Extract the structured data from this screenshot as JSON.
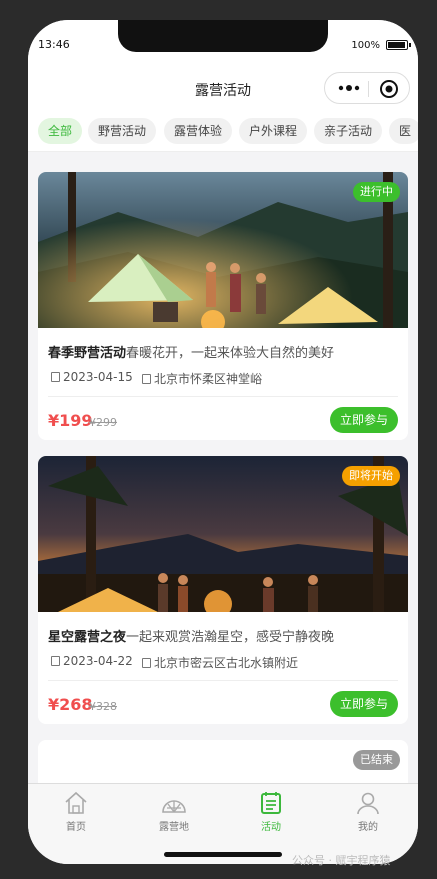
{
  "status": {
    "time": "13:46",
    "battery": "100%"
  },
  "nav": {
    "title": "露营活动"
  },
  "tabs": [
    "全部",
    "野营活动",
    "露营体验",
    "户外课程",
    "亲子活动",
    "医"
  ],
  "activities": [
    {
      "name": "春季野营活动",
      "desc": "春暖花开，一起来体验大自然的美好",
      "date": "2023-04-15",
      "location": "北京市怀柔区神堂峪",
      "price": "¥199",
      "original": "¥299",
      "status": "进行中",
      "status_color": "#3cbf2c",
      "button": "立即参与"
    },
    {
      "name": "星空露营之夜",
      "desc": "一起来观赏浩瀚星空，感受宁静夜晚",
      "date": "2023-04-22",
      "location": "北京市密云区古北水镇附近",
      "price": "¥268",
      "original": "¥328",
      "status": "即将开始",
      "status_color": "#f5a000",
      "button": "立即参与"
    },
    {
      "status": "已结束",
      "status_color": "#999999"
    }
  ],
  "tabbar": [
    "首页",
    "露营地",
    "活动",
    "我的"
  ],
  "watermark": "公众号 · 赋宇程序猿"
}
